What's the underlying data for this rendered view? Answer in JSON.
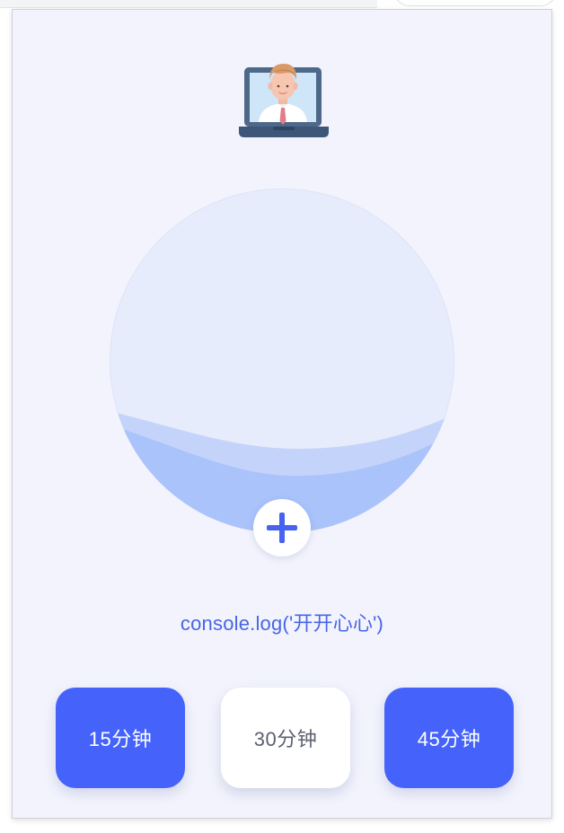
{
  "message": {
    "text": "console.log('开开心心')"
  },
  "icons": {
    "avatar": "avatar-laptop-icon",
    "add": "plus-icon"
  },
  "durations": [
    {
      "label": "15分钟",
      "selected": true
    },
    {
      "label": "30分钟",
      "selected": false
    },
    {
      "label": "45分钟",
      "selected": true
    }
  ],
  "colors": {
    "accent": "#4563fb",
    "background": "#f2f3fc",
    "ball": "#e6ecfb",
    "wave_light": "#c4d3fa",
    "wave_dark": "#abc3fb",
    "message_text": "#4865e6"
  }
}
